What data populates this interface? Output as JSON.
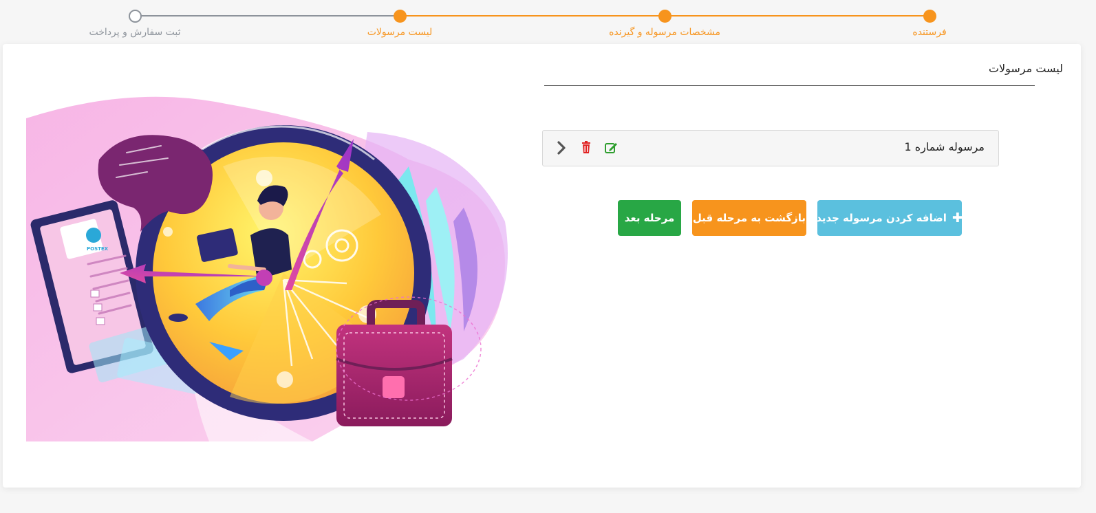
{
  "stepper": {
    "steps": [
      {
        "label": "فرستنده",
        "state": "done"
      },
      {
        "label": "مشخصات مرسوله و گیرنده",
        "state": "done"
      },
      {
        "label": "لیست مرسولات",
        "state": "done"
      },
      {
        "label": "ثبت سفارش و پرداخت",
        "state": "todo"
      }
    ]
  },
  "section": {
    "title": "لیست مرسولات"
  },
  "parcels": [
    {
      "label": "مرسوله شماره 1",
      "icons": [
        "edit-icon",
        "trash-icon",
        "chevron-right-icon"
      ]
    }
  ],
  "actions": {
    "add_label": "اضافه کردن مرسوله جدید",
    "back_label": "بازگشت به مرحله قبل",
    "next_label": "مرحله بعد"
  },
  "illustration": {
    "logo_text": "POSTEX"
  },
  "colors": {
    "accent": "#f7941d",
    "inactive": "#8d939b",
    "add_button": "#5bc0de",
    "next_button": "#28a745",
    "delete_icon": "#e02424",
    "edit_icon": "#2e9e2e"
  }
}
